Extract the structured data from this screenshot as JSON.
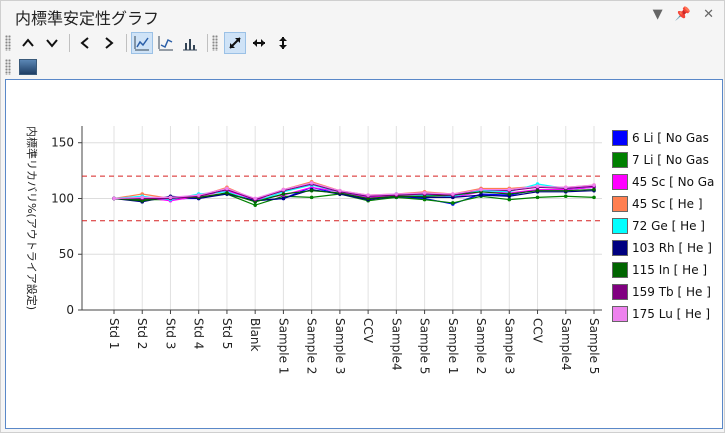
{
  "window": {
    "title": "内標準安定性グラフ",
    "buttons": [
      "▼",
      "📌",
      "✕"
    ]
  },
  "toolbar": {
    "row1": [
      {
        "name": "move-up-icon",
        "glyph": "⌃"
      },
      {
        "name": "move-down-icon",
        "glyph": "⌄"
      },
      {
        "name": "prev-icon",
        "glyph": "‹"
      },
      {
        "name": "next-icon",
        "glyph": "›"
      },
      {
        "name": "line-chart-icon",
        "glyph": "📈"
      },
      {
        "name": "line-chart-alt-icon",
        "glyph": "📉"
      },
      {
        "name": "bar-chart-icon",
        "glyph": "📊"
      },
      {
        "name": "fit-all-icon",
        "glyph": "⤢"
      },
      {
        "name": "fit-horizontal-icon",
        "glyph": "↔"
      },
      {
        "name": "fit-vertical-icon",
        "glyph": "↕"
      }
    ],
    "row2_icon": "image-icon"
  },
  "chart_data": {
    "type": "line",
    "ylabel": "内標準リカバリ%(アウトライア設定)",
    "ylim": [
      0,
      165
    ],
    "yticks": [
      0,
      50,
      100,
      150
    ],
    "limits": [
      80,
      120
    ],
    "categories": [
      "Std 1",
      "Std 2",
      "Std 3",
      "Std 4",
      "Std 5",
      "Blank",
      "Sample 1",
      "Sample 2",
      "Sample 3",
      "CCV",
      "Sample4",
      "Sample 5",
      "Sample 1",
      "Sample 2",
      "Sample 3",
      "CCV",
      "Sample4",
      "Sample 5"
    ],
    "series": [
      {
        "name": "6 Li [ No Gas",
        "color": "#0000ff",
        "values": [
          100,
          100,
          100,
          100,
          105,
          98,
          100,
          110,
          104,
          100,
          101,
          100,
          95,
          104,
          103,
          108,
          108,
          110
        ]
      },
      {
        "name": "7 Li [ No Gas",
        "color": "#008000",
        "values": [
          100,
          99,
          99,
          101,
          104,
          94,
          102,
          101,
          104,
          98,
          101,
          99,
          96,
          102,
          99,
          101,
          102,
          101
        ]
      },
      {
        "name": "45 Sc [ No Ga",
        "color": "#ff00ff",
        "values": [
          100,
          101,
          98,
          102,
          107,
          99,
          103,
          110,
          106,
          101,
          103,
          104,
          101,
          106,
          105,
          108,
          108,
          110
        ]
      },
      {
        "name": "45 Sc [ He ]",
        "color": "#ff7f50",
        "values": [
          100,
          104,
          100,
          102,
          110,
          99,
          108,
          115,
          107,
          103,
          104,
          106,
          104,
          109,
          109,
          111,
          110,
          112
        ]
      },
      {
        "name": "72 Ge [ He ]",
        "color": "#00ffff",
        "values": [
          100,
          102,
          99,
          104,
          106,
          97,
          106,
          112,
          106,
          102,
          104,
          103,
          102,
          107,
          106,
          113,
          109,
          111
        ]
      },
      {
        "name": "103 Rh [ He ]",
        "color": "#000080",
        "values": [
          100,
          97,
          102,
          100,
          104,
          98,
          100,
          108,
          104,
          99,
          102,
          101,
          101,
          103,
          102,
          106,
          106,
          107
        ]
      },
      {
        "name": "115 In [ He ]",
        "color": "#006400",
        "values": [
          100,
          98,
          101,
          101,
          105,
          97,
          104,
          107,
          105,
          100,
          102,
          102,
          103,
          106,
          104,
          107,
          107,
          108
        ]
      },
      {
        "name": "159 Tb [ He ]",
        "color": "#800080",
        "values": [
          100,
          100,
          100,
          102,
          108,
          99,
          107,
          113,
          106,
          102,
          103,
          104,
          103,
          108,
          107,
          110,
          109,
          111
        ]
      },
      {
        "name": "175 Lu [ He ]",
        "color": "#ee82ee",
        "values": [
          100,
          101,
          101,
          103,
          109,
          100,
          108,
          114,
          107,
          103,
          104,
          105,
          104,
          108,
          108,
          111,
          110,
          112
        ]
      }
    ]
  }
}
